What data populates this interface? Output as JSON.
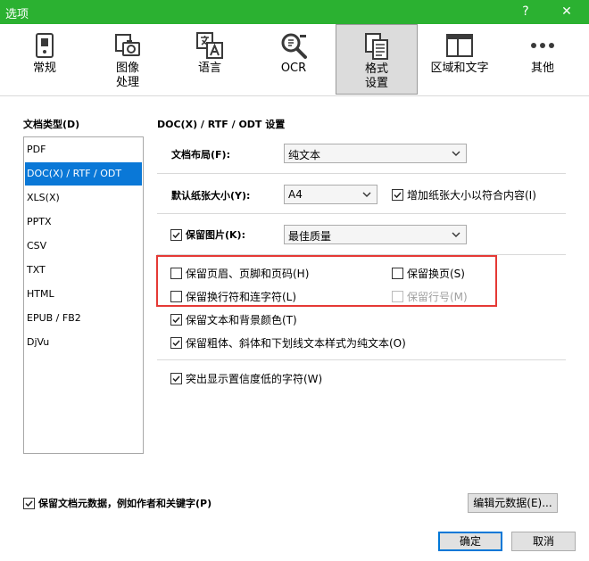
{
  "window": {
    "title": "选项",
    "help": "?",
    "close": "✕"
  },
  "toolbar": {
    "items": [
      {
        "label": "常规"
      },
      {
        "label": "图像\n处理"
      },
      {
        "label": "语言"
      },
      {
        "label": "OCR"
      },
      {
        "label": "格式\n设置",
        "active": true
      },
      {
        "label": "区域和文字"
      },
      {
        "label": "其他"
      }
    ]
  },
  "doc_types": {
    "label": "文档类型(D)",
    "items": [
      "PDF",
      "DOC(X) / RTF / ODT",
      "XLS(X)",
      "PPTX",
      "CSV",
      "TXT",
      "HTML",
      "EPUB / FB2",
      "DjVu"
    ],
    "selected": "DOC(X) / RTF / ODT"
  },
  "settings": {
    "heading": "DOC(X) / RTF / ODT 设置",
    "layout_label": "文档布局(F):",
    "layout_value": "纯文本",
    "paper_label": "默认纸张大小(Y):",
    "paper_value": "A4",
    "increase_paper": {
      "label": "增加纸张大小以符合内容(I)",
      "checked": true
    },
    "keep_images": {
      "label": "保留图片(K):",
      "checked": true
    },
    "image_quality": "最佳质量",
    "keep_headers": {
      "label": "保留页眉、页脚和页码(H)",
      "checked": false
    },
    "keep_page_breaks": {
      "label": "保留换页(S)",
      "checked": false
    },
    "keep_line_breaks": {
      "label": "保留换行符和连字符(L)",
      "checked": false
    },
    "keep_line_numbers": {
      "label": "保留行号(M)",
      "checked": false,
      "disabled": true
    },
    "keep_text_bg_color": {
      "label": "保留文本和背景颜色(T)",
      "checked": true
    },
    "keep_bold_italic": {
      "label": "保留粗体、斜体和下划线文本样式为纯文本(O)",
      "checked": true
    },
    "highlight_low_conf": {
      "label": "突出显示置信度低的字符(W)",
      "checked": true
    }
  },
  "footer": {
    "keep_metadata": {
      "label": "保留文档元数据，例如作者和关键字(P)",
      "checked": true
    },
    "edit_metadata": "编辑元数据(E)...",
    "ok": "确定",
    "cancel": "取消"
  },
  "colors": {
    "titlebar": "#2bb131",
    "selection": "#0a78d7",
    "highlight_box": "#e53935"
  }
}
